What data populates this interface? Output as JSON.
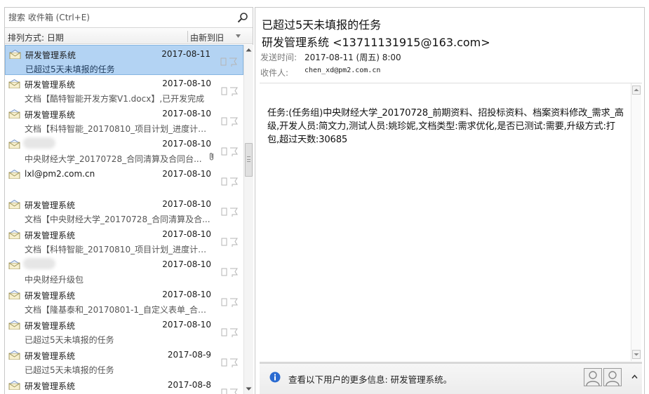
{
  "search": {
    "placeholder": "搜索 收件箱 (Ctrl+E)"
  },
  "sort": {
    "label": "排列方式: 日期",
    "order": "由新到旧"
  },
  "messages": [
    {
      "sender": "研发管理系统",
      "date": "2017-08-11",
      "subject": "已超过5天未填报的任务",
      "selected": true
    },
    {
      "sender": "研发管理系统",
      "date": "2017-08-10",
      "subject": "文档【酷特智能开发方案V1.docx】,已开发完成"
    },
    {
      "sender": "研发管理系统",
      "date": "2017-08-10",
      "subject": "文档【科特智能_20170810_项目计划_进度计划..."
    },
    {
      "sender": "",
      "date": "2017-08-10",
      "subject": "中央财经大学_20170728_合同清算及合同台...",
      "attachment": true,
      "redacted": true
    },
    {
      "sender": "lxl@pm2.com.cn",
      "date": "2017-08-10",
      "subject": ""
    },
    {
      "sender": "研发管理系统",
      "date": "2017-08-10",
      "subject": "文档【中央财经大学_20170728_合同清算及合..."
    },
    {
      "sender": "研发管理系统",
      "date": "2017-08-10",
      "subject": "文档【科特智能_20170810_项目计划_进度计划..."
    },
    {
      "sender": "",
      "date": "2017-08-10",
      "subject": "中央财经升级包",
      "redacted": true
    },
    {
      "sender": "研发管理系统",
      "date": "2017-08-10",
      "subject": "文档【隆基泰和_20170801-1_自定义表单_合同..."
    },
    {
      "sender": "研发管理系统",
      "date": "2017-08-10",
      "subject": "已超过5天未填报的任务"
    },
    {
      "sender": "研发管理系统",
      "date": "2017-08-9",
      "subject": "已超过5天未填报的任务"
    },
    {
      "sender": "研发管理系统",
      "date": "2017-08-8",
      "subject": ""
    }
  ],
  "mail": {
    "subject": "已超过5天未填报的任务",
    "from": "研发管理系统 <13711131915@163.com>",
    "sent_label": "发送时间:",
    "sent_value": "2017-08-11 (周五) 8:00",
    "to_label": "收件人:",
    "to_value": "chen_xd@pm2.com.cn",
    "body": "任务:(任务组)中央财经大学_20170728_前期资料、招投标资料、档案资料修改_需求_高级,开发人员:简文力,测试人员:姚珍妮,文档类型:需求优化,是否已测试:需要,升级方式:打包,超过天数:30685"
  },
  "people_pane": {
    "text": "查看以下用户的更多信息: 研发管理系统。"
  },
  "colors": {
    "selected_row": "#b3d3f3",
    "selected_border": "#86b5e1",
    "info_blue": "#2a6bd1"
  }
}
